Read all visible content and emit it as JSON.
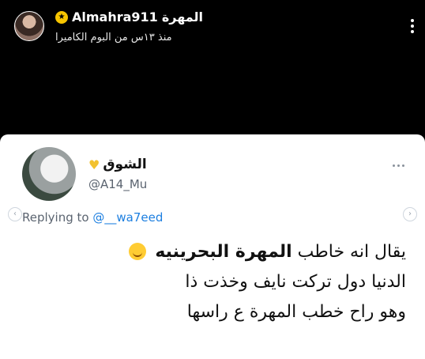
{
  "story": {
    "username": "Almahra911",
    "display_name": "المهرة",
    "subtitle": "منذ ١٣س من البوم الكاميرا"
  },
  "tweet": {
    "display_name": "الشوق",
    "handle": "@A14_Mu",
    "reply_prefix": "Replying to",
    "reply_to": "@__wa7eed",
    "line1_prefix": "يقال انه خاطب",
    "line1_bold": "المهرة البحرينيه",
    "line2": "الدنيا دول تركت نايف وخذت ذا",
    "line3": "وهو راح خطب المهرة ع راسها"
  },
  "icons": {
    "badge": "star-badge-icon",
    "heart": "yellow-heart-icon",
    "emoji": "rofl-emoji-icon"
  },
  "colors": {
    "background": "#000000",
    "card": "#ffffff",
    "link": "#1d7fe0",
    "badge": "#f7c500"
  }
}
